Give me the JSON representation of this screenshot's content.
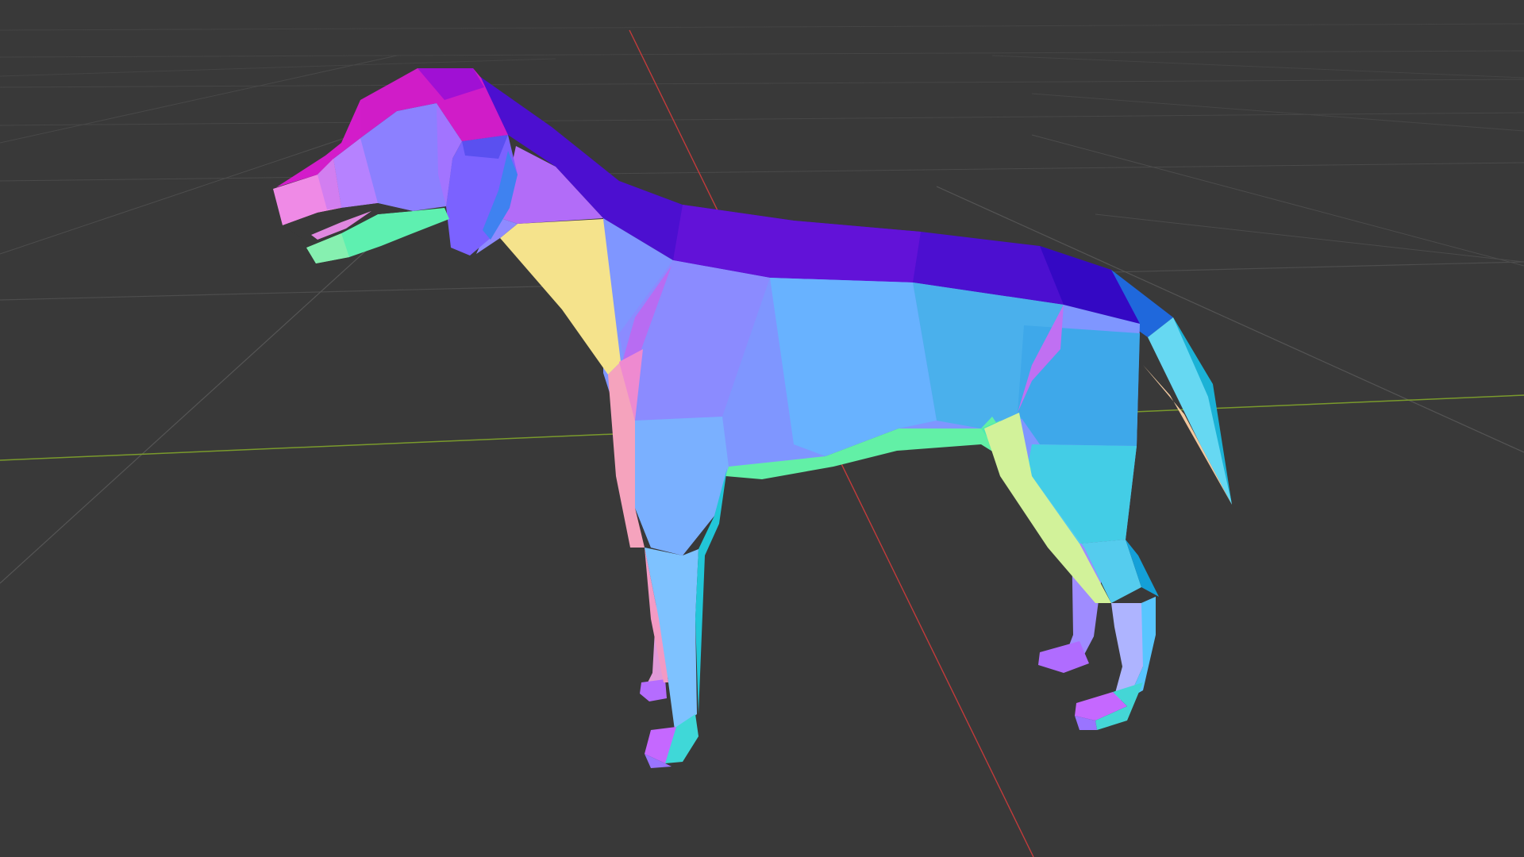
{
  "viewport": {
    "background_color": "#393939",
    "grid_color": "#4b4b4b",
    "x_axis_color": "#c23b3b",
    "y_axis_color": "#7a9a2c",
    "shading": "normal-map"
  },
  "model": {
    "subject": "low-poly dog",
    "palette": {
      "top": "#5a10d4",
      "head": "#d01cc8",
      "side": "#7ea0ff",
      "body_side": "#57b4f0",
      "underside": "#5ef0a8",
      "front": "#f0a0c0",
      "neck_front": "#f5e38c",
      "back": "#38c8e6"
    }
  }
}
